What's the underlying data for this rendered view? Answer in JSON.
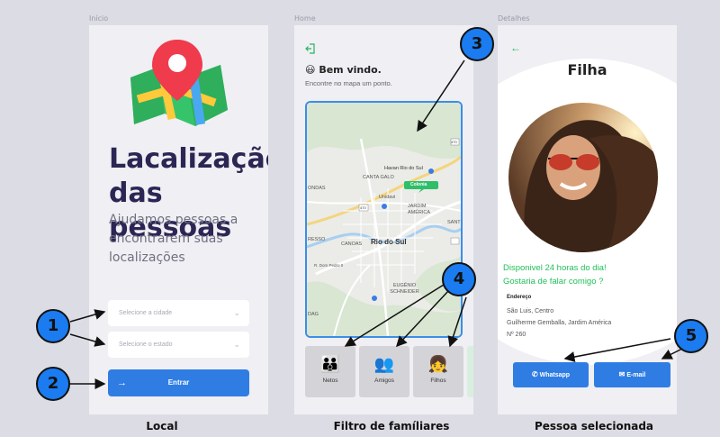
{
  "frames": {
    "inicio_label": "Início",
    "home_label": "Home",
    "detalhes_label": "Detalhes"
  },
  "captions": {
    "local": "Local",
    "filtro": "Filtro de famíliares",
    "pessoa": "Pessoa  selecionada"
  },
  "login": {
    "title_line1": "Lacalização",
    "title_line2": "das pessoas",
    "subtitle": "Ajudamos pessoas a encontrarem suas localizações",
    "city_placeholder": "Selecione a cidade",
    "state_placeholder": "Selecione o estado",
    "enter_label": "Entrar",
    "icons": [
      "map-pin-logo",
      "chevron-down-icon",
      "arrow-right-icon"
    ]
  },
  "home": {
    "welcome": "Bem vindo.",
    "hint": "Encontre no mapa um ponto.",
    "map_labels": {
      "havan": "Havan Rio do Sul",
      "canta_galo": "CANTA GALO",
      "unidavi": "Unidavi",
      "jardim_america": "JARDIM AMÉRICA",
      "rio_do_sul": "Rio do Sul",
      "canoas": "CANOAS",
      "eugenio": "EUGÊNIO SCHNEIDER",
      "colonia": "Colonia",
      "ssc": "SANT",
      "nova": "ONDAS",
      "ressa": "RESSO",
      "dom_pedro": "R. Dom Pedro II",
      "dag": "DAG",
      "road_470a": "470",
      "road_470b": "470"
    },
    "categories": [
      "Netos",
      "Amigos",
      "Filhos"
    ],
    "icons": [
      "logout-icon",
      "smile-emoji-icon",
      "netos-icon",
      "amigos-icon",
      "filhos-icon"
    ]
  },
  "detail": {
    "title": "Filha",
    "availability_line1": "Disponivel  24 horas do dia!",
    "availability_line2": "Gostaria de falar comigo ?",
    "address_heading": "Endereço",
    "address_line1": "São Luis, Centro",
    "address_line2": "Guilherme Gemballa, Jardim América",
    "address_line3": "Nº 260",
    "whatsapp_label": "Whatsapp",
    "email_label": "E-mail",
    "icons": [
      "back-arrow-icon",
      "whatsapp-icon",
      "mail-icon"
    ]
  },
  "callouts": [
    "1",
    "2",
    "3",
    "4",
    "5"
  ],
  "colors": {
    "accent": "#2f7de3",
    "title": "#2b2653",
    "available": "#22c05a",
    "callout": "#1a7cf0"
  }
}
